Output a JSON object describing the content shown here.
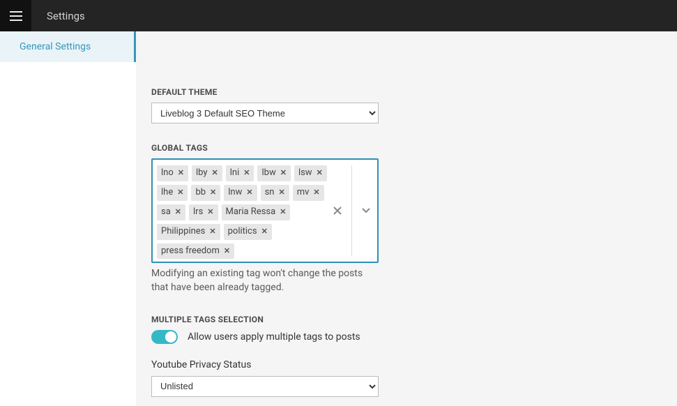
{
  "header": {
    "title": "Settings"
  },
  "sidebar": {
    "items": [
      {
        "label": "General Settings"
      }
    ]
  },
  "form": {
    "defaultTheme": {
      "label": "DEFAULT THEME",
      "value": "Liveblog 3 Default SEO Theme"
    },
    "globalTags": {
      "label": "GLOBAL TAGS",
      "tags": [
        "lno",
        "lby",
        "lni",
        "lbw",
        "lsw",
        "lhe",
        "bb",
        "lnw",
        "sn",
        "mv",
        "sa",
        "lrs",
        "Maria Ressa",
        "Philippines",
        "politics",
        "press freedom"
      ],
      "hint": "Modifying an existing tag won't change the posts that have been already tagged."
    },
    "multipleTags": {
      "label": "MULTIPLE TAGS SELECTION",
      "toggleLabel": "Allow users apply multiple tags to posts",
      "value": true
    },
    "youtube": {
      "label": "Youtube Privacy Status",
      "value": "Unlisted"
    }
  }
}
